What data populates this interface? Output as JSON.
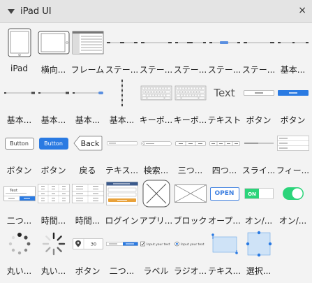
{
  "panel": {
    "title": "iPad UI",
    "close_label": "×"
  },
  "items": [
    {
      "label": "iPad",
      "icon": "ipad-portrait-icon"
    },
    {
      "label": "横向...",
      "icon": "ipad-landscape-icon"
    },
    {
      "label": "フレーム",
      "icon": "frame-icon"
    },
    {
      "label": "ステー...",
      "icon": "status-bar-icon"
    },
    {
      "label": "ステー...",
      "icon": "status-bar-icon"
    },
    {
      "label": "ステー...",
      "icon": "status-bar-icon"
    },
    {
      "label": "ステー...",
      "icon": "status-bar-icon"
    },
    {
      "label": "ステー...",
      "icon": "status-bar-icon"
    },
    {
      "label": "基本...",
      "icon": "basic-bar-icon"
    },
    {
      "label": "基本...",
      "icon": "basic-bar-icon"
    },
    {
      "label": "基本...",
      "icon": "basic-bar-icon"
    },
    {
      "label": "基本...",
      "icon": "basic-bar-icon"
    },
    {
      "label": "基本...",
      "icon": "basic-vertical-icon"
    },
    {
      "label": "キーボ...",
      "icon": "keyboard-icon"
    },
    {
      "label": "キーボ...",
      "icon": "keyboard-icon"
    },
    {
      "label": "テキスト",
      "icon": "text-icon",
      "text": "Text"
    },
    {
      "label": "ボタン",
      "icon": "button-icon"
    },
    {
      "label": "ボタン",
      "icon": "button-blue-icon"
    },
    {
      "label": "ボタン",
      "icon": "button-icon",
      "text": "Button"
    },
    {
      "label": "ボタン",
      "icon": "button-blue-icon",
      "text": "Button"
    },
    {
      "label": "戻る",
      "icon": "back-button-icon",
      "text": "Back"
    },
    {
      "label": "テキス...",
      "icon": "text-field-icon"
    },
    {
      "label": "検索...",
      "icon": "search-field-icon"
    },
    {
      "label": "三つ...",
      "icon": "segmented-three-icon"
    },
    {
      "label": "四つ...",
      "icon": "segmented-four-icon"
    },
    {
      "label": "スライ...",
      "icon": "slider-icon"
    },
    {
      "label": "フィー...",
      "icon": "field-list-icon"
    },
    {
      "label": "二つ...",
      "icon": "dialog-two-icon",
      "text": "Text"
    },
    {
      "label": "時間...",
      "icon": "time-picker-icon"
    },
    {
      "label": "時間...",
      "icon": "time-picker-icon"
    },
    {
      "label": "ログイン",
      "icon": "login-icon"
    },
    {
      "label": "アプリ...",
      "icon": "app-icon"
    },
    {
      "label": "ブロック",
      "icon": "block-icon"
    },
    {
      "label": "オープ...",
      "icon": "open-button-icon",
      "text": "OPEN"
    },
    {
      "label": "オン/...",
      "icon": "on-off-switch-icon",
      "text": "ON"
    },
    {
      "label": "オン/...",
      "icon": "toggle-icon"
    },
    {
      "label": "丸い...",
      "icon": "spinner-dots-icon"
    },
    {
      "label": "丸い...",
      "icon": "spinner-lines-icon"
    },
    {
      "label": "ボタン",
      "icon": "stepper-button-icon",
      "text": "30"
    },
    {
      "label": "二つ...",
      "icon": "two-field-icon"
    },
    {
      "label": "ラベル",
      "icon": "checkbox-label-icon",
      "text": "Input your text"
    },
    {
      "label": "ラジオ...",
      "icon": "radio-label-icon",
      "text": "Input your text"
    },
    {
      "label": "テキス...",
      "icon": "text-selection-icon"
    },
    {
      "label": "選択...",
      "icon": "selection-box-icon"
    }
  ],
  "colors": {
    "accent": "#2a7ae2",
    "green": "#2bd47a",
    "header_bg": "#e4e4e4",
    "panel_bg": "#f3f3f3"
  }
}
